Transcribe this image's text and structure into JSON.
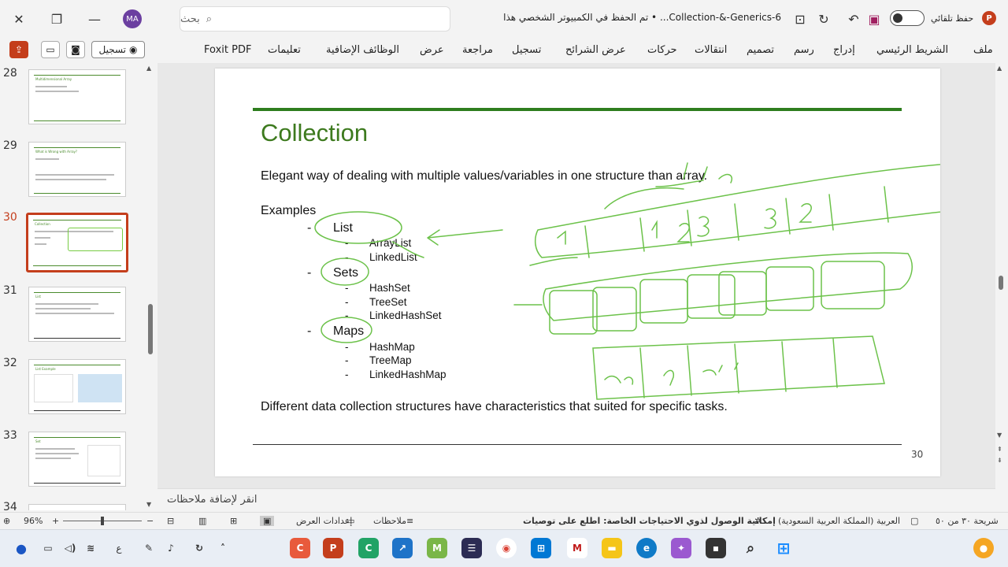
{
  "titlebar": {
    "close": "✕",
    "restore": "❐",
    "minimize": "—",
    "avatar": "MA",
    "search_placeholder": "بحث",
    "doc_title": "6-Collection-&-Generics... • تم الحفظ في الكمبيوتر الشخصي هذا",
    "autosave_label": "حفظ تلقائي",
    "ppt_logo": "P"
  },
  "ribbon": {
    "tabs": [
      "ملف",
      "الشريط الرئيسي",
      "إدراج",
      "رسم",
      "تصميم",
      "انتقالات",
      "حركات",
      "عرض الشرائح",
      "تسجيل",
      "مراجعة",
      "عرض",
      "الوظائف الإضافية",
      "تعليمات",
      "Foxit PDF"
    ],
    "record_button": "تسجيل"
  },
  "sidebar": {
    "slides": [
      {
        "num": "28",
        "title": "Multidimensional Array"
      },
      {
        "num": "29",
        "title": "What is Wrong with Array?"
      },
      {
        "num": "30",
        "title": "Collection"
      },
      {
        "num": "31",
        "title": "List"
      },
      {
        "num": "32",
        "title": "List Example"
      },
      {
        "num": "33",
        "title": "Set"
      },
      {
        "num": "34",
        "title": ""
      }
    ]
  },
  "slide": {
    "title": "Collection",
    "intro": "Elegant way of dealing with multiple values/variables in one structure than array.",
    "examples": "Examples",
    "dash": "-",
    "groups": [
      {
        "name": "List",
        "items": [
          "ArrayList",
          "LinkedList"
        ]
      },
      {
        "name": "Sets",
        "items": [
          "HashSet",
          "TreeSet",
          "LinkedHashSet"
        ]
      },
      {
        "name": "Maps",
        "items": [
          "HashMap",
          "TreeMap",
          "LinkedHashMap"
        ]
      }
    ],
    "conclusion": "Different data collection structures have characteristics that suited for specific tasks.",
    "number": "30"
  },
  "notes": {
    "placeholder": "انقر لإضافة ملاحظات"
  },
  "status": {
    "slide_count": "شريحة ٣٠ من ٥٠",
    "language": "العربية (المملكة العربية السعودية)",
    "accessibility": "إمكانية الوصول لذوي الاحتياجات الخاصة: اطلع على توصيات",
    "notes": "ملاحظات",
    "display_settings": "إعدادات العرض",
    "zoom": "96%"
  },
  "colors": {
    "accent": "#c43e1c",
    "slide_green": "#3d7a1e",
    "ink": "#6cc24a"
  }
}
